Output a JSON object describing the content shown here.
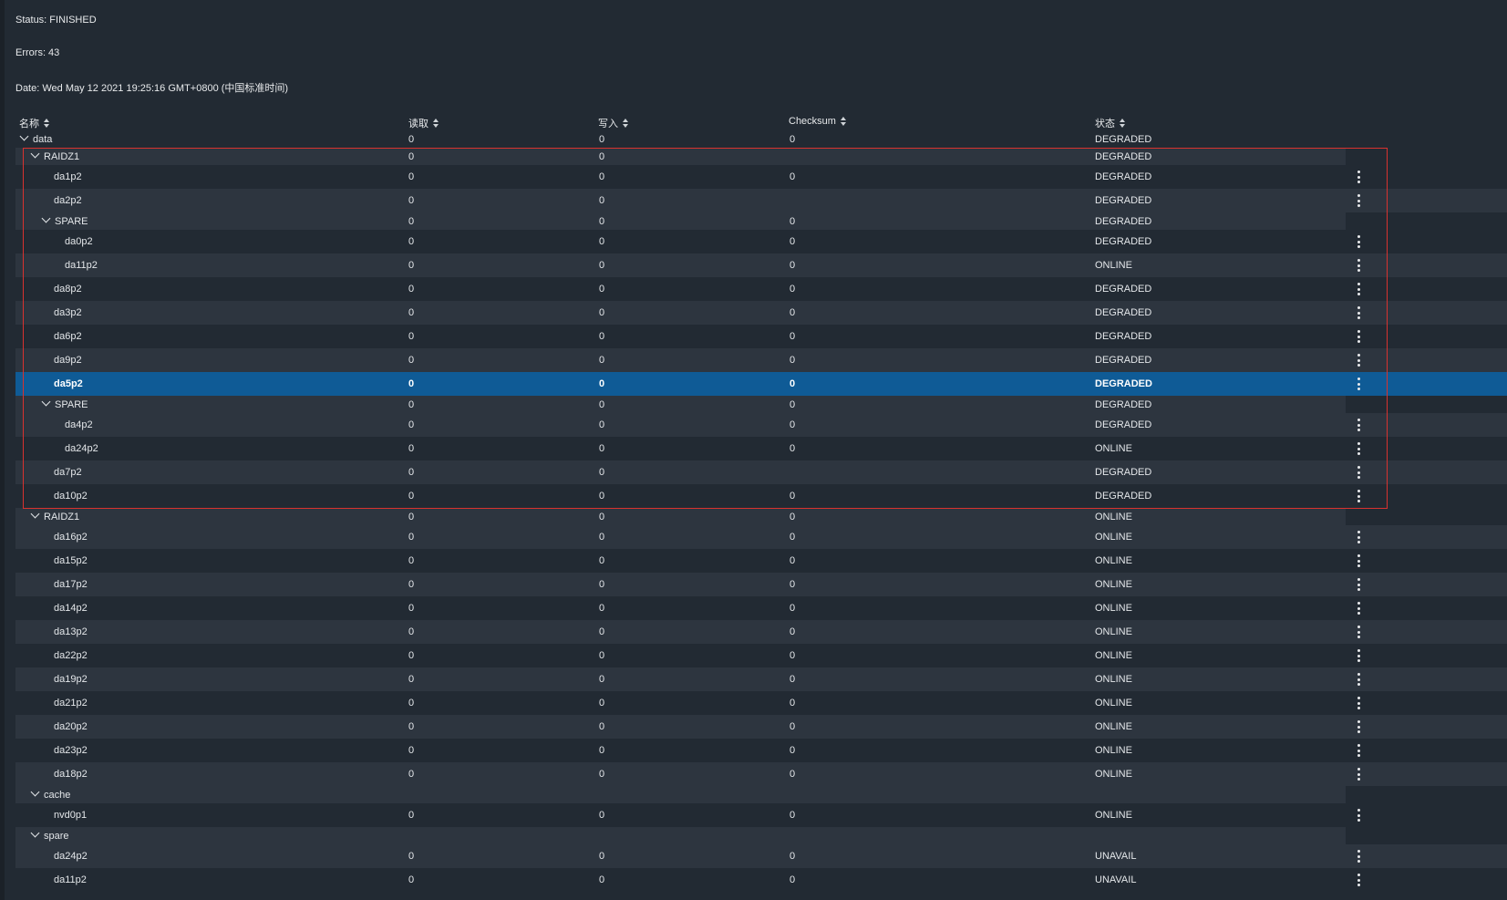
{
  "info": {
    "status": "Status: FINISHED",
    "errors": "Errors: 43",
    "date": "Date: Wed May 12 2021 19:25:16 GMT+0800 (中国标准时间)"
  },
  "columns": [
    "名称",
    "读取",
    "写入",
    "Checksum",
    "状态"
  ],
  "highlight_color": "#d8322f",
  "selected_color": "#0f5b96",
  "rows": [
    {
      "name": "data",
      "level": 0,
      "group": true,
      "read": "0",
      "write": "0",
      "checksum": "0",
      "state": "DEGRADED"
    },
    {
      "name": "RAIDZ1",
      "level": 1,
      "group": true,
      "read": "0",
      "write": "0",
      "checksum": "",
      "state": "DEGRADED"
    },
    {
      "name": "da1p2",
      "level": 2,
      "group": false,
      "read": "0",
      "write": "0",
      "checksum": "0",
      "state": "DEGRADED"
    },
    {
      "name": "da2p2",
      "level": 2,
      "group": false,
      "read": "0",
      "write": "0",
      "checksum": "",
      "state": "DEGRADED"
    },
    {
      "name": "SPARE",
      "level": 2,
      "group": true,
      "read": "0",
      "write": "0",
      "checksum": "0",
      "state": "DEGRADED"
    },
    {
      "name": "da0p2",
      "level": 3,
      "group": false,
      "read": "0",
      "write": "0",
      "checksum": "0",
      "state": "DEGRADED"
    },
    {
      "name": "da11p2",
      "level": 3,
      "group": false,
      "read": "0",
      "write": "0",
      "checksum": "0",
      "state": "ONLINE"
    },
    {
      "name": "da8p2",
      "level": 2,
      "group": false,
      "read": "0",
      "write": "0",
      "checksum": "0",
      "state": "DEGRADED"
    },
    {
      "name": "da3p2",
      "level": 2,
      "group": false,
      "read": "0",
      "write": "0",
      "checksum": "0",
      "state": "DEGRADED"
    },
    {
      "name": "da6p2",
      "level": 2,
      "group": false,
      "read": "0",
      "write": "0",
      "checksum": "0",
      "state": "DEGRADED"
    },
    {
      "name": "da9p2",
      "level": 2,
      "group": false,
      "read": "0",
      "write": "0",
      "checksum": "0",
      "state": "DEGRADED"
    },
    {
      "name": "da5p2",
      "level": 2,
      "group": false,
      "read": "0",
      "write": "0",
      "checksum": "0",
      "state": "DEGRADED",
      "selected": true
    },
    {
      "name": "SPARE",
      "level": 2,
      "group": true,
      "read": "0",
      "write": "0",
      "checksum": "0",
      "state": "DEGRADED"
    },
    {
      "name": "da4p2",
      "level": 3,
      "group": false,
      "read": "0",
      "write": "0",
      "checksum": "0",
      "state": "DEGRADED"
    },
    {
      "name": "da24p2",
      "level": 3,
      "group": false,
      "read": "0",
      "write": "0",
      "checksum": "0",
      "state": "ONLINE"
    },
    {
      "name": "da7p2",
      "level": 2,
      "group": false,
      "read": "0",
      "write": "0",
      "checksum": "",
      "state": "DEGRADED"
    },
    {
      "name": "da10p2",
      "level": 2,
      "group": false,
      "read": "0",
      "write": "0",
      "checksum": "0",
      "state": "DEGRADED"
    },
    {
      "name": "RAIDZ1",
      "level": 1,
      "group": true,
      "read": "0",
      "write": "0",
      "checksum": "0",
      "state": "ONLINE"
    },
    {
      "name": "da16p2",
      "level": 2,
      "group": false,
      "read": "0",
      "write": "0",
      "checksum": "0",
      "state": "ONLINE"
    },
    {
      "name": "da15p2",
      "level": 2,
      "group": false,
      "read": "0",
      "write": "0",
      "checksum": "0",
      "state": "ONLINE"
    },
    {
      "name": "da17p2",
      "level": 2,
      "group": false,
      "read": "0",
      "write": "0",
      "checksum": "0",
      "state": "ONLINE"
    },
    {
      "name": "da14p2",
      "level": 2,
      "group": false,
      "read": "0",
      "write": "0",
      "checksum": "0",
      "state": "ONLINE"
    },
    {
      "name": "da13p2",
      "level": 2,
      "group": false,
      "read": "0",
      "write": "0",
      "checksum": "0",
      "state": "ONLINE"
    },
    {
      "name": "da22p2",
      "level": 2,
      "group": false,
      "read": "0",
      "write": "0",
      "checksum": "0",
      "state": "ONLINE"
    },
    {
      "name": "da19p2",
      "level": 2,
      "group": false,
      "read": "0",
      "write": "0",
      "checksum": "0",
      "state": "ONLINE"
    },
    {
      "name": "da21p2",
      "level": 2,
      "group": false,
      "read": "0",
      "write": "0",
      "checksum": "0",
      "state": "ONLINE"
    },
    {
      "name": "da20p2",
      "level": 2,
      "group": false,
      "read": "0",
      "write": "0",
      "checksum": "0",
      "state": "ONLINE"
    },
    {
      "name": "da23p2",
      "level": 2,
      "group": false,
      "read": "0",
      "write": "0",
      "checksum": "0",
      "state": "ONLINE"
    },
    {
      "name": "da18p2",
      "level": 2,
      "group": false,
      "read": "0",
      "write": "0",
      "checksum": "0",
      "state": "ONLINE"
    },
    {
      "name": "cache",
      "level": 1,
      "group": true,
      "read": "",
      "write": "",
      "checksum": "",
      "state": ""
    },
    {
      "name": "nvd0p1",
      "level": 2,
      "group": false,
      "read": "0",
      "write": "0",
      "checksum": "0",
      "state": "ONLINE"
    },
    {
      "name": "spare",
      "level": 1,
      "group": true,
      "read": "",
      "write": "",
      "checksum": "",
      "state": ""
    },
    {
      "name": "da24p2",
      "level": 2,
      "group": false,
      "read": "0",
      "write": "0",
      "checksum": "0",
      "state": "UNAVAIL"
    },
    {
      "name": "da11p2",
      "level": 2,
      "group": false,
      "read": "0",
      "write": "0",
      "checksum": "0",
      "state": "UNAVAIL"
    }
  ]
}
